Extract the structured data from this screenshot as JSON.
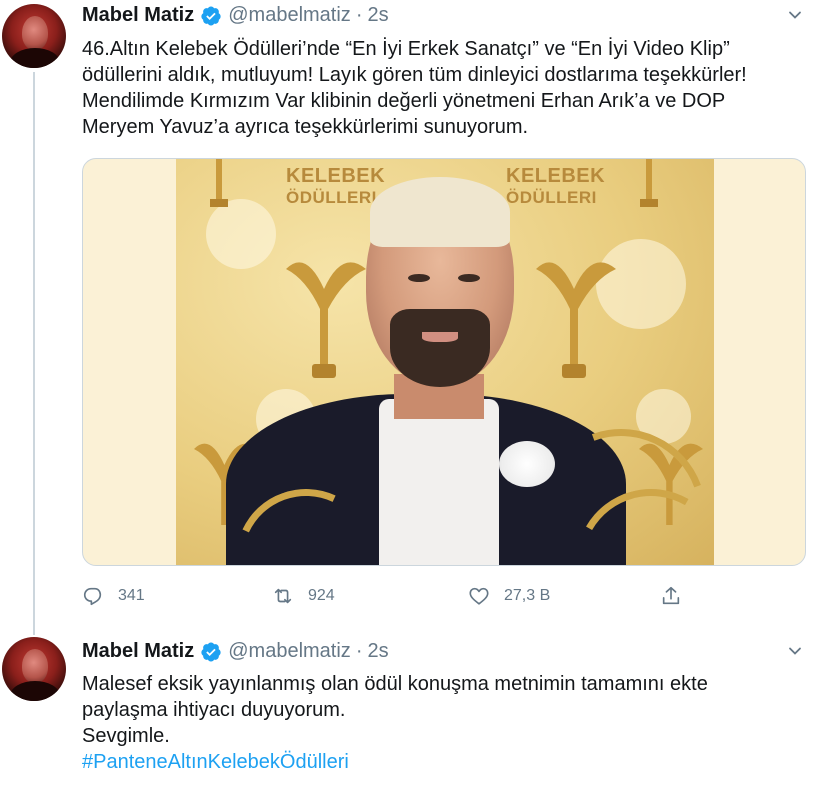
{
  "tweets": [
    {
      "author_name": "Mabel Matiz",
      "handle": "@mabelmatiz",
      "separator": "·",
      "time": "2s",
      "text_lines": [
        "46.Altın Kelebek Ödülleri’nde “En İyi Erkek Sanatçı” ve “En İyi Video Klip”",
        "ödüllerini aldık, mutluyum! Layık gören tüm dinleyici dostlarıma teşekkürler!",
        "Mendilimde Kırmızım Var klibinin değerli yönetmeni Erhan Arık’a ve DOP",
        "Meryem Yavuz’a ayrıca teşekkürlerimi sunuyorum."
      ],
      "media": {
        "brand_line1_left": "KELEBEK",
        "brand_line2_left": "ÖDÜLLERI",
        "brand_line1_right": "KELEBEK",
        "brand_line2_right": "ÖDÜLLERI"
      },
      "actions": {
        "reply_count": "341",
        "retweet_count": "924",
        "like_count": "27,3 B"
      }
    },
    {
      "author_name": "Mabel Matiz",
      "handle": "@mabelmatiz",
      "separator": "·",
      "time": "2s",
      "text_lines": [
        "Malesef eksik yayınlanmış olan ödül konuşma metnimin tamamını ekte",
        "paylaşma ihtiyacı duyuyorum.",
        "Sevgimle."
      ],
      "hashtag": "#PanteneAltınKelebekÖdülleri"
    }
  ],
  "colors": {
    "accent": "#1da1f2",
    "secondary_text": "#657786",
    "border": "#ccd6dd"
  },
  "icons": {
    "verified": "verified-badge-icon",
    "caret": "chevron-down-icon",
    "reply": "reply-icon",
    "retweet": "retweet-icon",
    "like": "heart-icon",
    "share": "share-icon"
  }
}
